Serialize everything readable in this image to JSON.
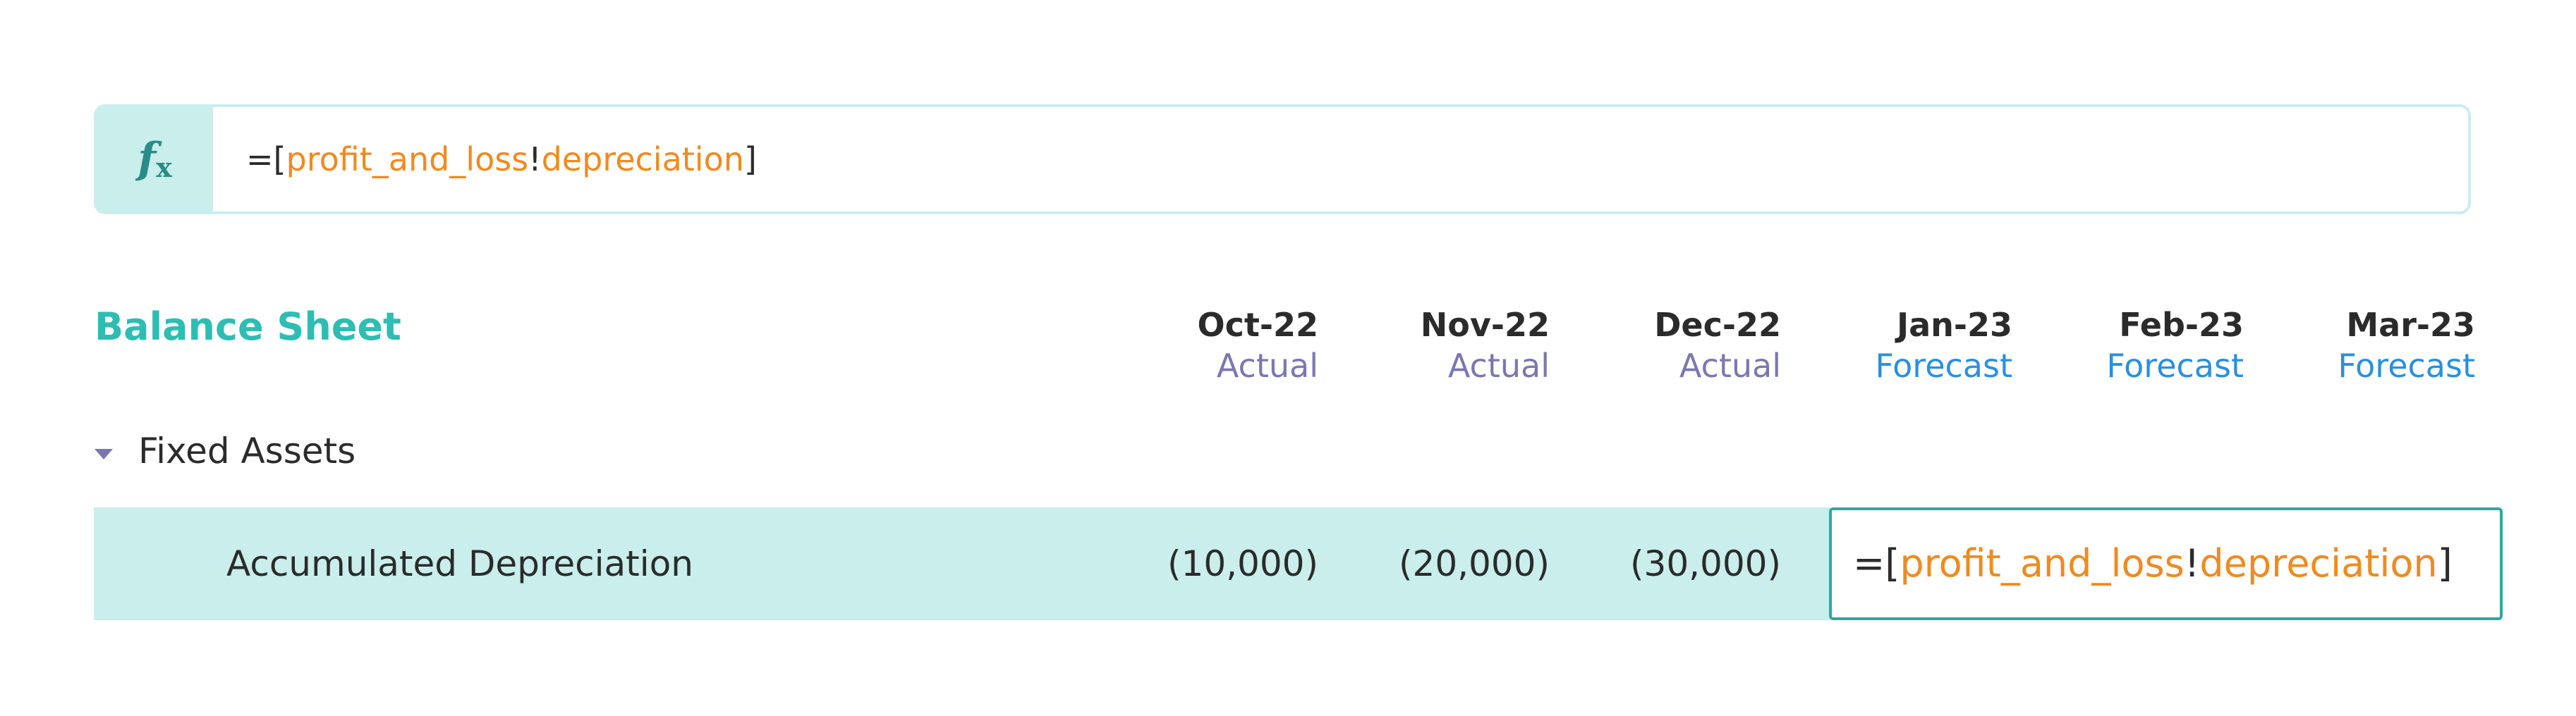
{
  "formula_bar": {
    "icon": "fx-icon",
    "prefix": "=[",
    "ref_sheet": "profit_and_loss",
    "separator": "!",
    "ref_field": "depreciation",
    "suffix": "]"
  },
  "sheet": {
    "title": "Balance Sheet",
    "periods": [
      {
        "month": "Oct-22",
        "type": "Actual"
      },
      {
        "month": "Nov-22",
        "type": "Actual"
      },
      {
        "month": "Dec-22",
        "type": "Actual"
      },
      {
        "month": "Jan-23",
        "type": "Forecast"
      },
      {
        "month": "Feb-23",
        "type": "Forecast"
      },
      {
        "month": "Mar-23",
        "type": "Forecast"
      }
    ],
    "group": {
      "label": "Fixed Assets",
      "icon": "caret-down-icon"
    },
    "row": {
      "label": "Accumulated Depreciation",
      "values": [
        "(10,000)",
        "(20,000)",
        "(30,000)"
      ],
      "active_cell": {
        "prefix": "=[",
        "ref_sheet": "profit_and_loss",
        "separator": "!",
        "ref_field": "depreciation",
        "suffix": "]"
      }
    }
  },
  "colors": {
    "accent": "#2ebdb2",
    "highlight_row": "#c9eeec",
    "actual": "#7a77b0",
    "forecast": "#2a8fe0",
    "reference": "#f08a1e"
  }
}
